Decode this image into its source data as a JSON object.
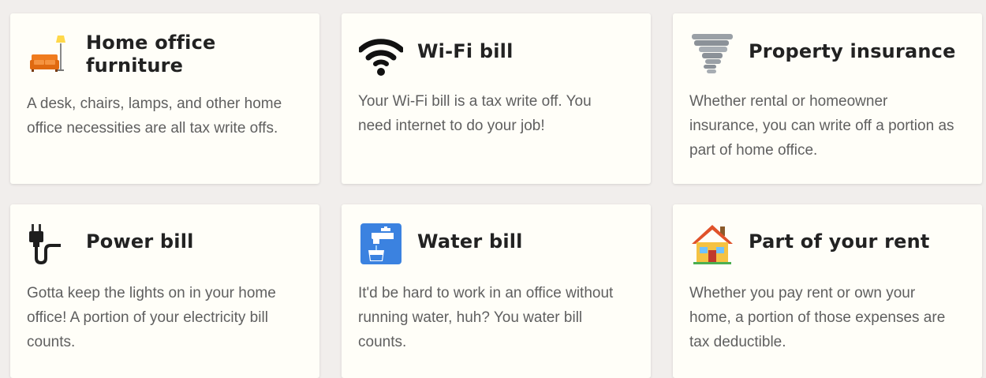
{
  "cards": [
    {
      "icon": "couch-and-lamp-icon",
      "title": "Home office furniture",
      "title_line1": "Home office",
      "title_line2": "furniture",
      "description": "A desk, chairs, lamps, and other home office necessities are all tax write offs."
    },
    {
      "icon": "wifi-icon",
      "title": "Wi-Fi bill",
      "description": "Your Wi-Fi bill is a tax write off. You need internet to do your job!"
    },
    {
      "icon": "tornado-icon",
      "title": "Property insurance",
      "description": "Whether rental or homeowner insurance, you can write off a portion as part of home office."
    },
    {
      "icon": "electric-plug-icon",
      "title": "Power bill",
      "description": "Gotta keep the lights on in your home office! A portion of your electricity bill counts."
    },
    {
      "icon": "water-tap-icon",
      "title": "Water bill",
      "description": "It'd be hard to work in an office without running water, huh? You water bill counts."
    },
    {
      "icon": "house-icon",
      "title": "Part of your rent",
      "description": "Whether you pay rent or own your home, a portion of those expenses are tax deductible."
    }
  ],
  "colors": {
    "page_background": "#f1eeec",
    "card_background": "#fffef8",
    "title_text": "#222222",
    "body_text": "#5f5f5f",
    "water_tile": "#3b82e0",
    "couch": "#f07b1e",
    "house_roof": "#e0522a"
  }
}
